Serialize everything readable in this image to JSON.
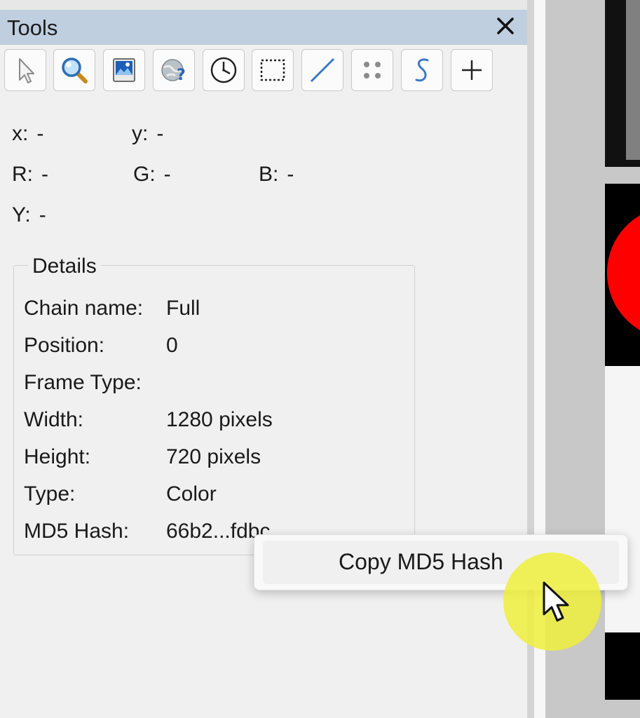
{
  "panel": {
    "title": "Tools",
    "close_icon": "close-icon"
  },
  "toolbar": [
    {
      "name": "pointer-tool",
      "icon": "arrow-pointer-icon"
    },
    {
      "name": "zoom-tool",
      "icon": "magnifier-icon"
    },
    {
      "name": "image-tool",
      "icon": "picture-icon"
    },
    {
      "name": "help-tool",
      "icon": "globe-question-icon"
    },
    {
      "name": "timer-tool",
      "icon": "clock-icon"
    },
    {
      "name": "rect-select-tool",
      "icon": "dashed-rect-icon"
    },
    {
      "name": "line-tool",
      "icon": "line-icon"
    },
    {
      "name": "dots-tool",
      "icon": "dots-icon"
    },
    {
      "name": "curve-tool",
      "icon": "s-curve-icon"
    },
    {
      "name": "add-tool",
      "icon": "plus-icon"
    }
  ],
  "readouts": {
    "x": {
      "label": "x:",
      "value": "-"
    },
    "y": {
      "label": "y:",
      "value": "-"
    },
    "r": {
      "label": "R:",
      "value": "-"
    },
    "g": {
      "label": "G:",
      "value": "-"
    },
    "b": {
      "label": "B:",
      "value": "-"
    },
    "luma": {
      "label": "Y:",
      "value": "-"
    }
  },
  "details": {
    "legend": "Details",
    "rows": [
      {
        "label": "Chain name:",
        "value": "Full"
      },
      {
        "label": "Position:",
        "value": "0"
      },
      {
        "label": "Frame Type:",
        "value": ""
      },
      {
        "label": "Width:",
        "value": "1280 pixels"
      },
      {
        "label": "Height:",
        "value": "720 pixels"
      },
      {
        "label": "Type:",
        "value": "Color"
      },
      {
        "label": "MD5 Hash:",
        "value": "66b2...fdbc"
      }
    ]
  },
  "context_menu": {
    "items": [
      {
        "label": "Copy MD5 Hash"
      }
    ]
  },
  "colors": {
    "title_bar": "#bfcfdf",
    "panel_bg": "#f0f0f0",
    "accent_blue": "#3a78c4",
    "red": "#ff0000",
    "cursor_halo": "#eeee3c"
  }
}
